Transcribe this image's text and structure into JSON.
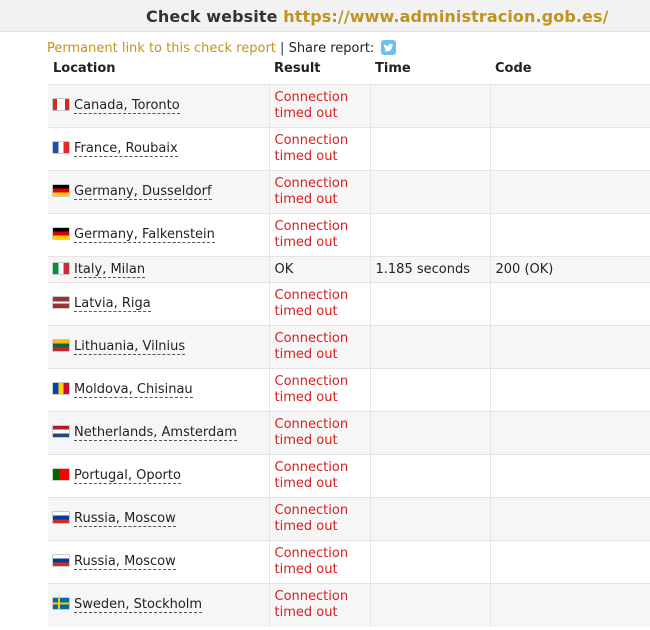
{
  "header": {
    "title_prefix": "Check website",
    "url": "https://www.administracion.gob.es/"
  },
  "links": {
    "permanent": "Permanent link to this check report",
    "separator": "|",
    "share": "Share report:",
    "twitter_icon": "twitter-icon"
  },
  "table": {
    "columns": [
      "Location",
      "Result",
      "Time",
      "Code"
    ],
    "rows": [
      {
        "flag": "canada",
        "location": "Canada, Toronto",
        "result": "Connection timed out",
        "time": "",
        "code": "",
        "status": "error"
      },
      {
        "flag": "france",
        "location": "France, Roubaix",
        "result": "Connection timed out",
        "time": "",
        "code": "",
        "status": "error"
      },
      {
        "flag": "germany",
        "location": "Germany, Dusseldorf",
        "result": "Connection timed out",
        "time": "",
        "code": "",
        "status": "error"
      },
      {
        "flag": "germany",
        "location": "Germany, Falkenstein",
        "result": "Connection timed out",
        "time": "",
        "code": "",
        "status": "error"
      },
      {
        "flag": "italy",
        "location": "Italy, Milan",
        "result": "OK",
        "time": "1.185 seconds",
        "code": "200 (OK)",
        "status": "ok"
      },
      {
        "flag": "latvia",
        "location": "Latvia, Riga",
        "result": "Connection timed out",
        "time": "",
        "code": "",
        "status": "error"
      },
      {
        "flag": "lithuania",
        "location": "Lithuania, Vilnius",
        "result": "Connection timed out",
        "time": "",
        "code": "",
        "status": "error"
      },
      {
        "flag": "moldova",
        "location": "Moldova, Chisinau",
        "result": "Connection timed out",
        "time": "",
        "code": "",
        "status": "error"
      },
      {
        "flag": "netherlands",
        "location": "Netherlands, Amsterdam",
        "result": "Connection timed out",
        "time": "",
        "code": "",
        "status": "error"
      },
      {
        "flag": "portugal",
        "location": "Portugal, Oporto",
        "result": "Connection timed out",
        "time": "",
        "code": "",
        "status": "error"
      },
      {
        "flag": "russia",
        "location": "Russia, Moscow",
        "result": "Connection timed out",
        "time": "",
        "code": "",
        "status": "error"
      },
      {
        "flag": "russia",
        "location": "Russia, Moscow",
        "result": "Connection timed out",
        "time": "",
        "code": "",
        "status": "error"
      },
      {
        "flag": "sweden",
        "location": "Sweden, Stockholm",
        "result": "Connection timed out",
        "time": "",
        "code": "",
        "status": "error"
      }
    ]
  },
  "colors": {
    "accent": "#c2921f",
    "error": "#d81f1f",
    "row_alt": "#f6f6f6"
  }
}
